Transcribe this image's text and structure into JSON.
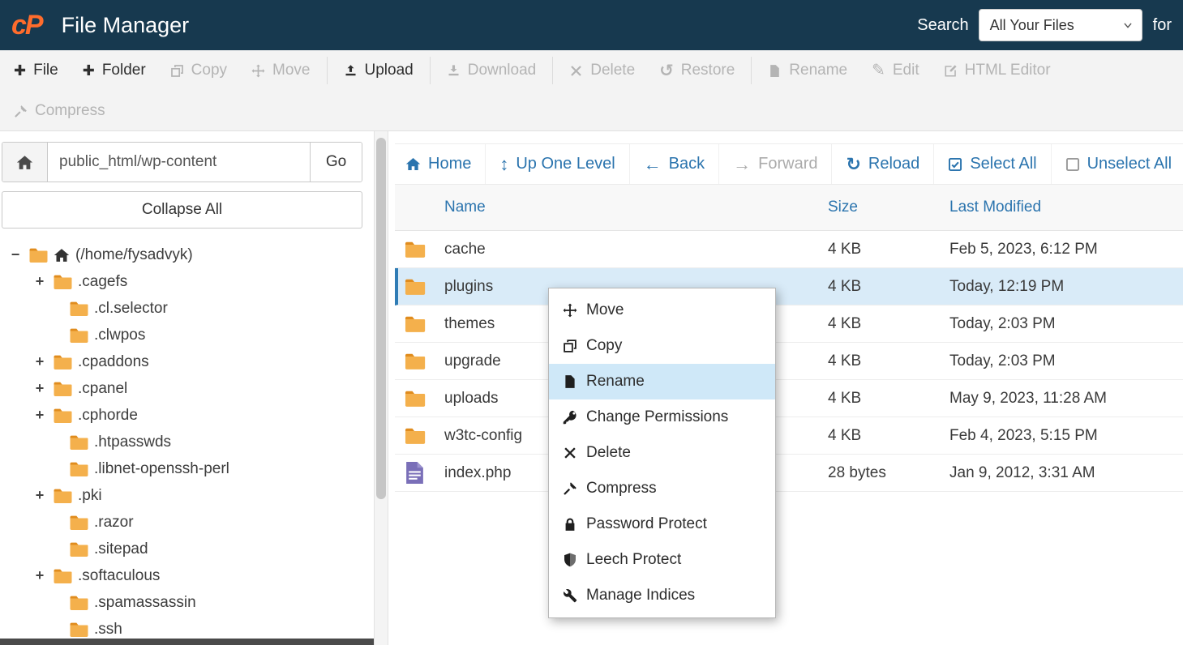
{
  "header": {
    "logo_text": "cP",
    "app_title": "File Manager",
    "search_label": "Search",
    "search_scope_value": "All Your Files",
    "for_label": "for"
  },
  "toolbar": {
    "row1": [
      {
        "label": "File",
        "icon": "add-file-icon",
        "enabled": true
      },
      {
        "label": "Folder",
        "icon": "add-folder-icon",
        "enabled": true
      },
      {
        "label": "Copy",
        "icon": "copy-icon",
        "enabled": false
      },
      {
        "label": "Move",
        "icon": "move-icon",
        "enabled": false
      },
      {
        "label": "Upload",
        "icon": "upload-icon",
        "enabled": true
      },
      {
        "label": "Download",
        "icon": "download-icon",
        "enabled": false
      },
      {
        "label": "Delete",
        "icon": "delete-icon",
        "enabled": false
      },
      {
        "label": "Restore",
        "icon": "restore-icon",
        "enabled": false
      },
      {
        "label": "Rename",
        "icon": "rename-icon",
        "enabled": false
      },
      {
        "label": "Edit",
        "icon": "edit-icon",
        "enabled": false
      },
      {
        "label": "HTML Editor",
        "icon": "html-editor-icon",
        "enabled": false
      }
    ],
    "row2": [
      {
        "label": "Compress",
        "icon": "compress-icon",
        "enabled": false
      }
    ]
  },
  "sidebar": {
    "path_value": "public_html/wp-content",
    "go_label": "Go",
    "collapse_all_label": "Collapse All",
    "tree_root": {
      "toggle": "−",
      "label": "(/home/fysadvyk)"
    },
    "tree_items": [
      {
        "toggle": "+",
        "label": ".cagefs"
      },
      {
        "toggle": "",
        "label": ".cl.selector"
      },
      {
        "toggle": "",
        "label": ".clwpos"
      },
      {
        "toggle": "+",
        "label": ".cpaddons"
      },
      {
        "toggle": "+",
        "label": ".cpanel"
      },
      {
        "toggle": "+",
        "label": ".cphorde"
      },
      {
        "toggle": "",
        "label": ".htpasswds"
      },
      {
        "toggle": "",
        "label": ".libnet-openssh-perl"
      },
      {
        "toggle": "+",
        "label": ".pki"
      },
      {
        "toggle": "",
        "label": ".razor"
      },
      {
        "toggle": "",
        "label": ".sitepad"
      },
      {
        "toggle": "+",
        "label": ".softaculous"
      },
      {
        "toggle": "",
        "label": ".spamassassin"
      },
      {
        "toggle": "",
        "label": ".ssh"
      }
    ]
  },
  "filenav": {
    "items": [
      {
        "label": "Home",
        "icon": "home-icon",
        "enabled": true
      },
      {
        "label": "Up One Level",
        "icon": "up-one-level-icon",
        "enabled": true
      },
      {
        "label": "Back",
        "icon": "back-icon",
        "enabled": true
      },
      {
        "label": "Forward",
        "icon": "forward-icon",
        "enabled": false
      },
      {
        "label": "Reload",
        "icon": "reload-icon",
        "enabled": true
      },
      {
        "label": "Select All",
        "icon": "select-all-icon",
        "enabled": true
      },
      {
        "label": "Unselect All",
        "icon": "unselect-all-icon",
        "enabled": true
      }
    ]
  },
  "file_table": {
    "headers": {
      "name": "Name",
      "size": "Size",
      "last_modified": "Last Modified"
    },
    "rows": [
      {
        "name": "cache",
        "type": "folder",
        "size": "4 KB",
        "last_modified": "Feb 5, 2023, 6:12 PM",
        "selected": false
      },
      {
        "name": "plugins",
        "type": "folder",
        "size": "4 KB",
        "last_modified": "Today, 12:19 PM",
        "selected": true
      },
      {
        "name": "themes",
        "type": "folder",
        "size": "4 KB",
        "last_modified": "Today, 2:03 PM",
        "selected": false
      },
      {
        "name": "upgrade",
        "type": "folder",
        "size": "4 KB",
        "last_modified": "Today, 2:03 PM",
        "selected": false
      },
      {
        "name": "uploads",
        "type": "folder",
        "size": "4 KB",
        "last_modified": "May 9, 2023, 11:28 AM",
        "selected": false
      },
      {
        "name": "w3tc-config",
        "type": "folder",
        "size": "4 KB",
        "last_modified": "Feb 4, 2023, 5:15 PM",
        "selected": false
      },
      {
        "name": "index.php",
        "type": "file",
        "size": "28 bytes",
        "last_modified": "Jan 9, 2012, 3:31 AM",
        "selected": false
      }
    ]
  },
  "context_menu": {
    "items": [
      {
        "label": "Move",
        "icon": "move-icon",
        "highlighted": false
      },
      {
        "label": "Copy",
        "icon": "copy-icon",
        "highlighted": false
      },
      {
        "label": "Rename",
        "icon": "rename-icon",
        "highlighted": true
      },
      {
        "label": "Change Permissions",
        "icon": "key-icon",
        "highlighted": false
      },
      {
        "label": "Delete",
        "icon": "delete-icon",
        "highlighted": false
      },
      {
        "label": "Compress",
        "icon": "compress-icon",
        "highlighted": false
      },
      {
        "label": "Password Protect",
        "icon": "lock-icon",
        "highlighted": false
      },
      {
        "label": "Leech Protect",
        "icon": "shield-icon",
        "highlighted": false
      },
      {
        "label": "Manage Indices",
        "icon": "wrench-icon",
        "highlighted": false
      }
    ]
  },
  "colors": {
    "header_bg": "#17394f",
    "logo_orange": "#ff6c2c",
    "link_blue": "#2b74ae",
    "toolbar_bg": "#f3f3f3",
    "disabled_gray": "#b4b4b4",
    "selected_row_bg": "#d9ebf8",
    "menu_highlight_bg": "#cfe8f8",
    "folder_orange": "#f4b04c",
    "file_purple": "#7a6fb8"
  }
}
